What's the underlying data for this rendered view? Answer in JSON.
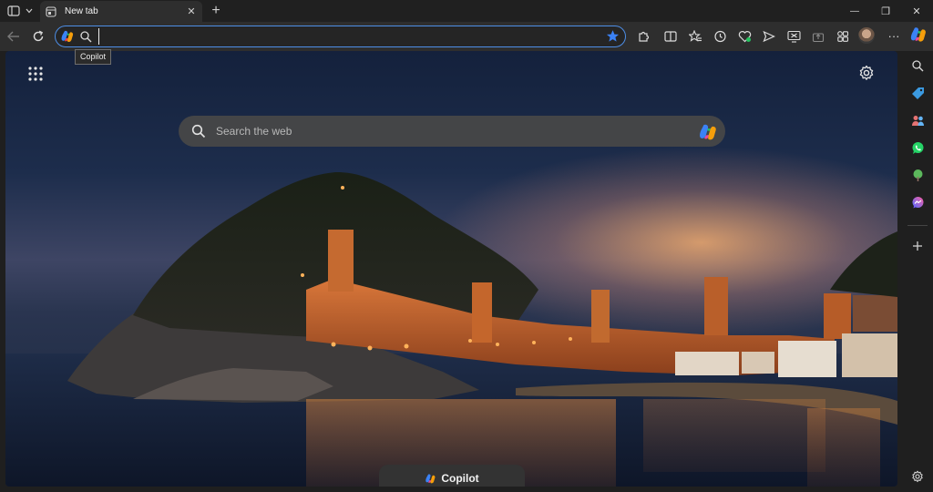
{
  "tab": {
    "title": "New tab",
    "close_glyph": "✕"
  },
  "titlebar": {
    "new_tab_glyph": "+",
    "minimize_glyph": "—",
    "restore_glyph": "❐",
    "close_glyph": "✕"
  },
  "omnibox": {
    "value": "",
    "placeholder": ""
  },
  "tooltip": {
    "text": "Copilot"
  },
  "toolbar": {
    "more_glyph": "···"
  },
  "newtab_page": {
    "search": {
      "placeholder": "Search the web"
    },
    "copilot_pill_label": "Copilot"
  },
  "icons": {
    "sidebar_toggle": "sidebar-toggle-icon",
    "back": "back-arrow-icon",
    "refresh": "refresh-icon",
    "search": "search-icon",
    "favorite_star": "star-icon",
    "extensions": "puzzle-icon",
    "split_screen": "split-screen-icon",
    "favorites": "favorites-icon",
    "history": "history-icon",
    "browser_essentials": "heart-pulse-icon",
    "share": "send-icon",
    "screenshot": "screenshot-icon",
    "collections": "collections-icon",
    "sidebar_search": "search-icon",
    "shopping": "tag-icon",
    "profile_tools": "people-icon",
    "whatsapp": "whatsapp-icon",
    "tree": "tree-icon",
    "messenger": "messenger-icon",
    "add": "plus-icon",
    "settings": "gear-icon",
    "apps": "apps-grid-icon"
  },
  "colors": {
    "accent": "#4d8ee6",
    "star": "#3b82f6",
    "whatsapp": "#25d366",
    "tree": "#5cb85c",
    "tag": "#3b9ae1"
  }
}
